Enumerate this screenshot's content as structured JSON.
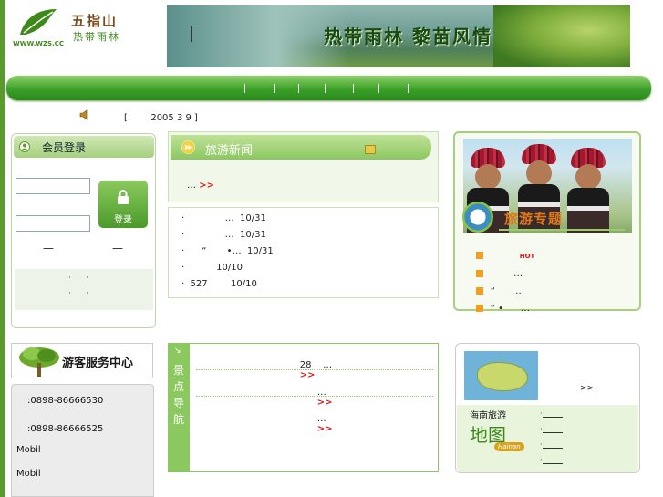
{
  "header": {
    "logo_name": "五指山",
    "logo_sub": "热带雨林",
    "logo_url": "WWW.WZS.CC",
    "banner_slogan": "热带雨林  黎苗风情"
  },
  "ticker": {
    "text": "[        2005 3 9 ]"
  },
  "member": {
    "title": "会员登录",
    "login_label": "登录",
    "dash_left": "—",
    "dash_right": "—",
    "dots": [
      "·",
      "·",
      "·",
      "·"
    ]
  },
  "news": {
    "title": "旅游新闻",
    "more_text": "…",
    "more_arrow": ">>"
  },
  "news_list": [
    "·              …  10/31",
    "·              …  10/31",
    "·      “       •…  10/31",
    "·           10/10",
    "·  527        10/10"
  ],
  "topics": {
    "title": "旅游专题",
    "items": [
      {
        "text": "",
        "hot": "HOT"
      },
      {
        "text": "        …",
        "hot": ""
      },
      {
        "text": "“       …",
        "hot": ""
      },
      {
        "text": "“ •      …",
        "hot": ""
      }
    ]
  },
  "service": {
    "title": "游客服务中心",
    "lines": [
      ":0898-86666530",
      ":0898-86666525",
      "Mobil",
      "Mobil"
    ]
  },
  "scenic": {
    "side_arrow": "↘",
    "side_title": "景点导航",
    "rows": [
      {
        "text": "28    …",
        "arrow": ">>"
      },
      {
        "text": "…",
        "arrow": ">>"
      },
      {
        "text": "…",
        "arrow": ">>"
      }
    ]
  },
  "map": {
    "more": ">>",
    "label": "海南旅游",
    "big_text": "地图",
    "sign": "Hainan",
    "link_dots": [
      "·",
      "·",
      "·",
      "·"
    ]
  }
}
